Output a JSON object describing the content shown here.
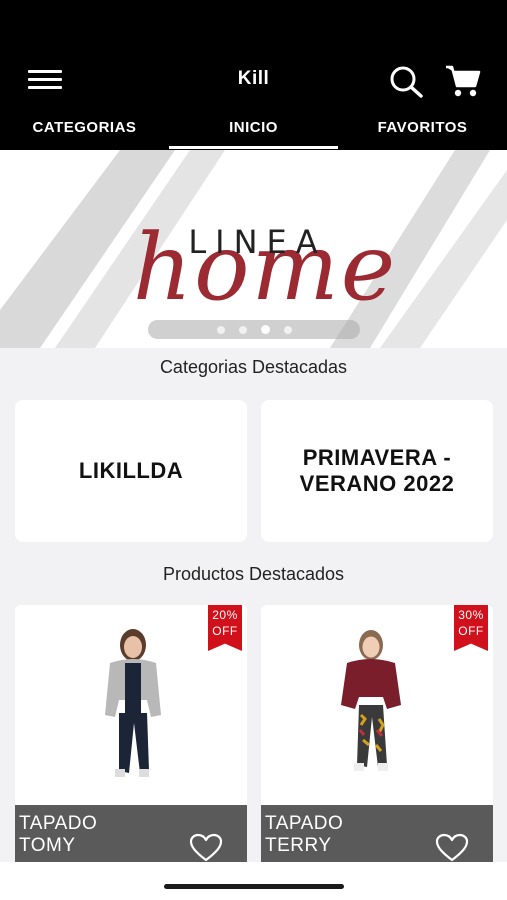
{
  "header": {
    "title": "Kill",
    "tabs": [
      {
        "label": "CATEGORIAS"
      },
      {
        "label": "INICIO"
      },
      {
        "label": "FAVORITOS"
      }
    ],
    "active_tab": "INICIO"
  },
  "banner": {
    "line1": "LINEA",
    "line2": "home",
    "slides": 4,
    "active_slide": 3,
    "accent": "#9b2a32"
  },
  "categories_section": {
    "title": "Categorias Destacadas",
    "items": [
      {
        "label": "LIKILLDA"
      },
      {
        "label": "PRIMAVERA - VERANO 2022"
      }
    ]
  },
  "products_section": {
    "title": "Productos Destacados",
    "items": [
      {
        "name_line1": "TAPADO",
        "name_line2": "TOMY",
        "discount_pct": "20%",
        "discount_label": "OFF",
        "coat_color": "#b8b8b8"
      },
      {
        "name_line1": "TAPADO",
        "name_line2": "TERRY",
        "discount_pct": "30%",
        "discount_label": "OFF",
        "coat_color": "#7a1e2c"
      }
    ]
  },
  "colors": {
    "header_bg": "#000000",
    "badge_red": "#d0101a",
    "product_footer": "#5a5a5a"
  }
}
